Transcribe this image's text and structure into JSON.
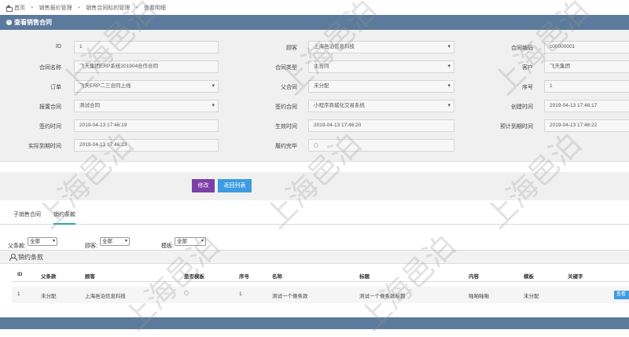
{
  "breadcrumb": [
    "首页",
    "销售报价管理",
    "销售合同标的管理",
    "查看明细"
  ],
  "panel_title": "查看销售合同",
  "form": {
    "id_label": "ID",
    "id_value": "1",
    "customer_label": "顾客",
    "customer_value": "上海邑泊信息科技",
    "contract_code_label": "合同编码",
    "contract_code_value": "c00000001",
    "contract_name_label": "合同名称",
    "contract_name_value": "飞天集团ERP系统201904合作合同",
    "contract_type_label": "合同类型",
    "contract_type_value": "主合同",
    "customer2_label": "客户",
    "customer2_value": "飞天集团",
    "order_label": "订单",
    "order_value": "飞天ERP二三合同上线",
    "parent_contract_label": "父合同",
    "parent_contract_value": "未分配",
    "seq_label": "序号",
    "seq_value": "1",
    "quote_contract_label": "报置合同",
    "quote_contract_value": "测试合同",
    "signed_contract_label": "签约合同",
    "signed_contract_value": "小程序商城化交易系统",
    "created_label": "创建时间",
    "created_value": "2019-04-13 17:46:17",
    "signed_time_label": "签约时间",
    "signed_time_value": "2019-04-13 17:46:19",
    "effective_label": "生效时间",
    "effective_value": "2019-04-13 17:46:20",
    "expected_expire_label": "预计到期时间",
    "expected_expire_value": "2019-04-13 17:46:22",
    "actual_expire_label": "实际到期时间",
    "actual_expire_value": "2019-04-13 17:46:23",
    "performing_label": "履约完毕"
  },
  "buttons": {
    "edit": "修改",
    "back": "返回列表"
  },
  "tabs": [
    "子销售合同",
    "销约条款"
  ],
  "filters": {
    "parent_label": "父条款:",
    "parent_value": "全部",
    "customer_label": "顾客:",
    "customer_value": "全部",
    "template_label": "模板:",
    "template_value": "全部"
  },
  "section_title": "销约条款",
  "table": {
    "headers": [
      "ID",
      "父条款",
      "顾客",
      "是否模板",
      "序号",
      "名称",
      "标题",
      "内容",
      "模板",
      "关键字"
    ],
    "rows": [
      [
        "1",
        "未分配",
        "上海邑泊信息科技",
        "",
        "1",
        "测试一个條条款",
        "测试一个條条款标题",
        "啪啪啪啪",
        "未分配",
        ""
      ]
    ],
    "view_button": "查看"
  },
  "watermark_text": "上海邑泊"
}
